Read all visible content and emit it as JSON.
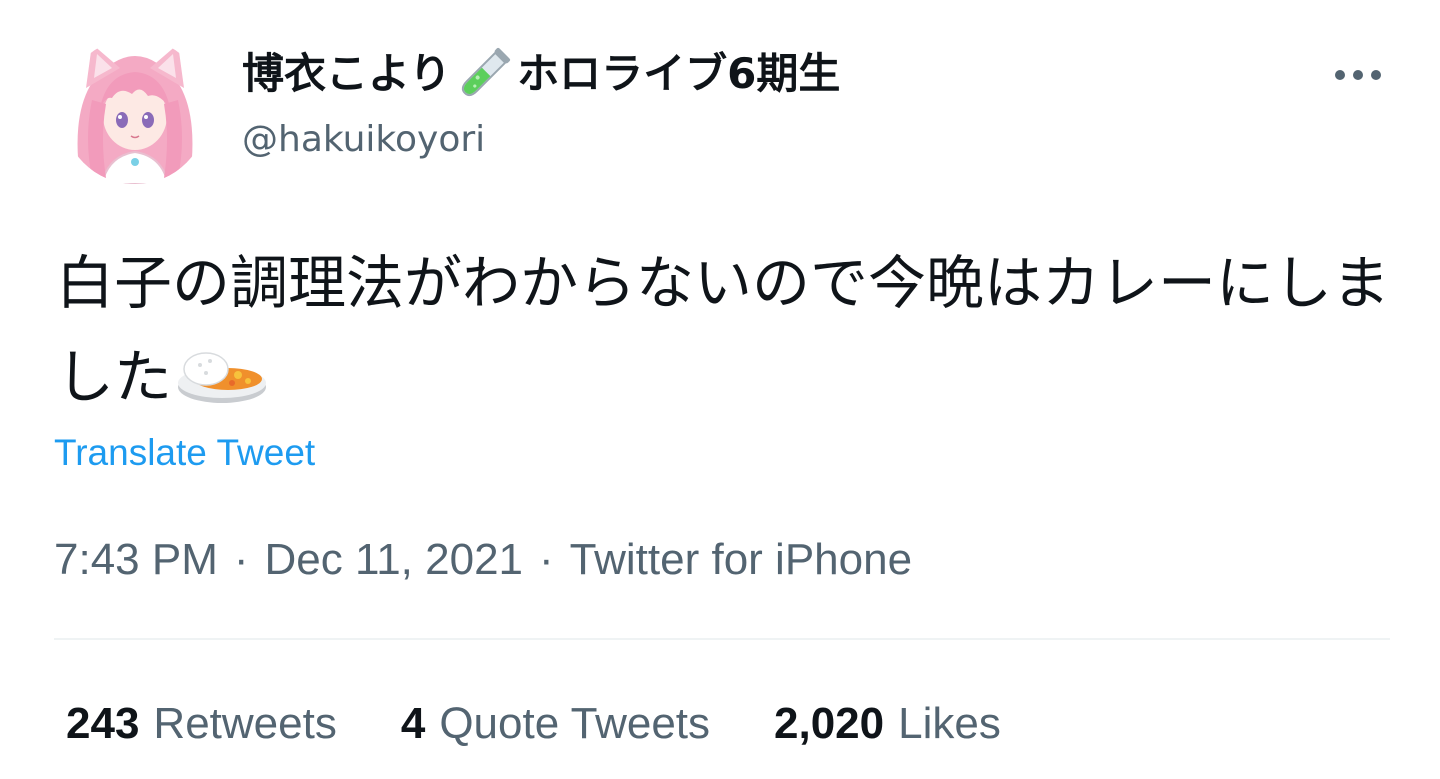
{
  "author": {
    "display_name_part1": "博衣こより",
    "display_name_part2": "ホロライブ6期生",
    "name_emoji": "test-tube-icon",
    "handle": "@hakuikoyori",
    "avatar": "avatar-pink-hair-catgirl"
  },
  "tweet": {
    "text": "白子の調理法がわからないので今晩はカレーにしました",
    "emoji": "curry-rice-icon"
  },
  "translate_label": "Translate Tweet",
  "meta": {
    "time": "7:43 PM",
    "date": "Dec 11, 2021",
    "source": "Twitter for iPhone",
    "separator": "·"
  },
  "stats": {
    "retweets_count": "243",
    "retweets_label": "Retweets",
    "quotes_count": "4",
    "quotes_label": "Quote Tweets",
    "likes_count": "2,020",
    "likes_label": "Likes"
  },
  "colors": {
    "link": "#1d9bf0",
    "secondary_text": "#536471",
    "primary_text": "#0f1419",
    "divider": "#eff3f4"
  }
}
